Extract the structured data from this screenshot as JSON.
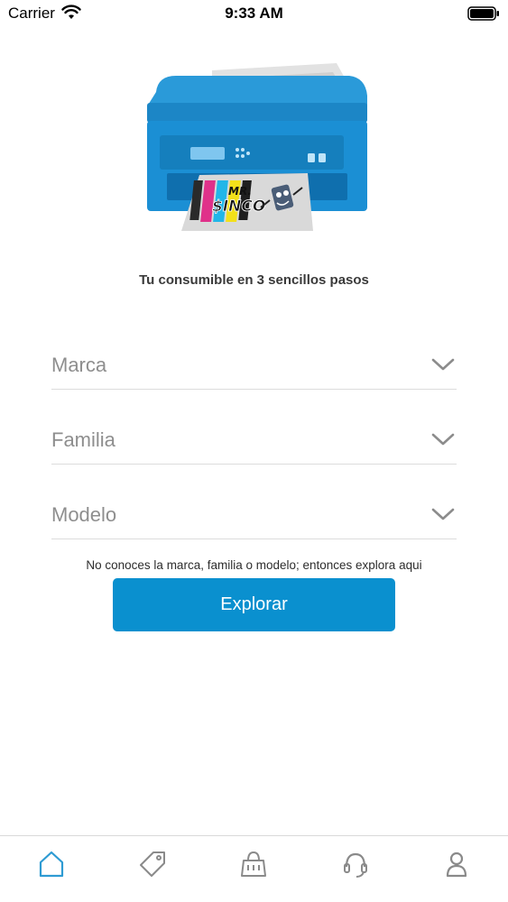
{
  "status_bar": {
    "carrier": "Carrier",
    "time": "9:33 AM"
  },
  "hero": {
    "logo_text": "MR. SINCO",
    "colors": {
      "printer": "#1b8fd4",
      "printer_dark": "#0f6fae",
      "paper": "#d9d9d9"
    }
  },
  "tagline": "Tu consumible en 3 sencillos pasos",
  "selectors": [
    {
      "label": "Marca"
    },
    {
      "label": "Familia"
    },
    {
      "label": "Modelo"
    }
  ],
  "helper_text": "No conoces la marca, familia o modelo; entonces explora aqui",
  "explore_button": {
    "label": "Explorar",
    "color": "#0a90cf"
  },
  "tab_bar": {
    "active_color": "#2e9bd3",
    "inactive_color": "#8a8a8a",
    "tabs": [
      {
        "icon": "home-icon",
        "active": true
      },
      {
        "icon": "tag-icon",
        "active": false
      },
      {
        "icon": "shopping-bag-icon",
        "active": false
      },
      {
        "icon": "headset-icon",
        "active": false
      },
      {
        "icon": "user-icon",
        "active": false
      }
    ]
  }
}
